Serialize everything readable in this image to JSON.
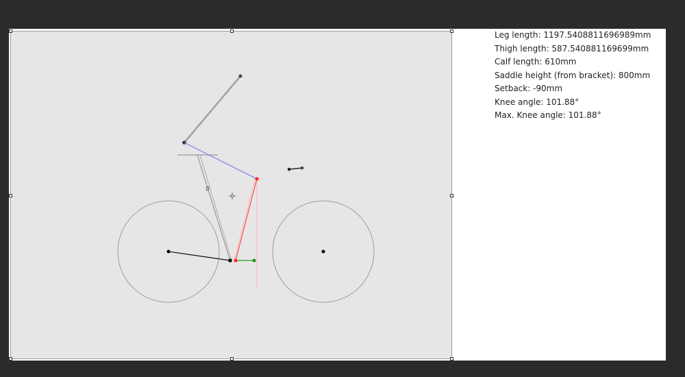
{
  "measurements": [
    {
      "id": "leg_length",
      "text": "Leg length: 1197.5408811696989mm"
    },
    {
      "id": "thigh_length",
      "text": "Thigh length: 587.540881169699mm"
    },
    {
      "id": "calf_length",
      "text": "Calf length: 610mm"
    },
    {
      "id": "saddle_height",
      "text": "Saddle height (from bracket): 800mm"
    },
    {
      "id": "setback",
      "text": "Setback: -90mm"
    },
    {
      "id": "knee_angle",
      "text": "Knee angle: 101.88°"
    },
    {
      "id": "max_knee_angle",
      "text": "Max. Knee angle: 101.88°"
    }
  ],
  "colors": {
    "thigh": "#7a7aff",
    "calf": "#ff4a4a",
    "foot": "#2aa02a",
    "frame": "#888888",
    "background": "#e6e6e6",
    "outer": "#2b2b2b"
  }
}
